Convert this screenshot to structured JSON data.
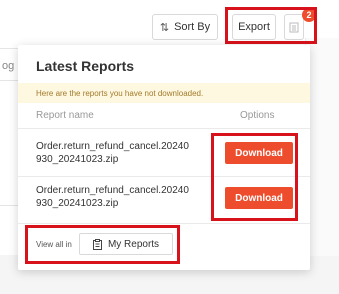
{
  "toolbar": {
    "sort_label": "Sort By",
    "sort_icon": "sort-arrows-icon",
    "export_label": "Export",
    "menu_icon": "list-icon",
    "notification_count": "2"
  },
  "background": {
    "partial_label": "og"
  },
  "popover": {
    "title": "Latest Reports",
    "notice": "Here are the reports you have not downloaded.",
    "columns": {
      "name": "Report name",
      "options": "Options"
    },
    "reports": [
      {
        "line1": "Order.return_refund_cancel.20240",
        "line2": "930_20241023.zip",
        "action": "Download"
      },
      {
        "line1": "Order.return_refund_cancel.20240",
        "line2": "930_20241023.zip",
        "action": "Download"
      }
    ],
    "footer": {
      "view_all": "View all in",
      "my_reports": "My Reports",
      "my_reports_icon": "document-icon"
    }
  },
  "colors": {
    "accent": "#ee4d2d",
    "highlight_box": "#d8121b",
    "notice_bg": "#fff8e1"
  }
}
